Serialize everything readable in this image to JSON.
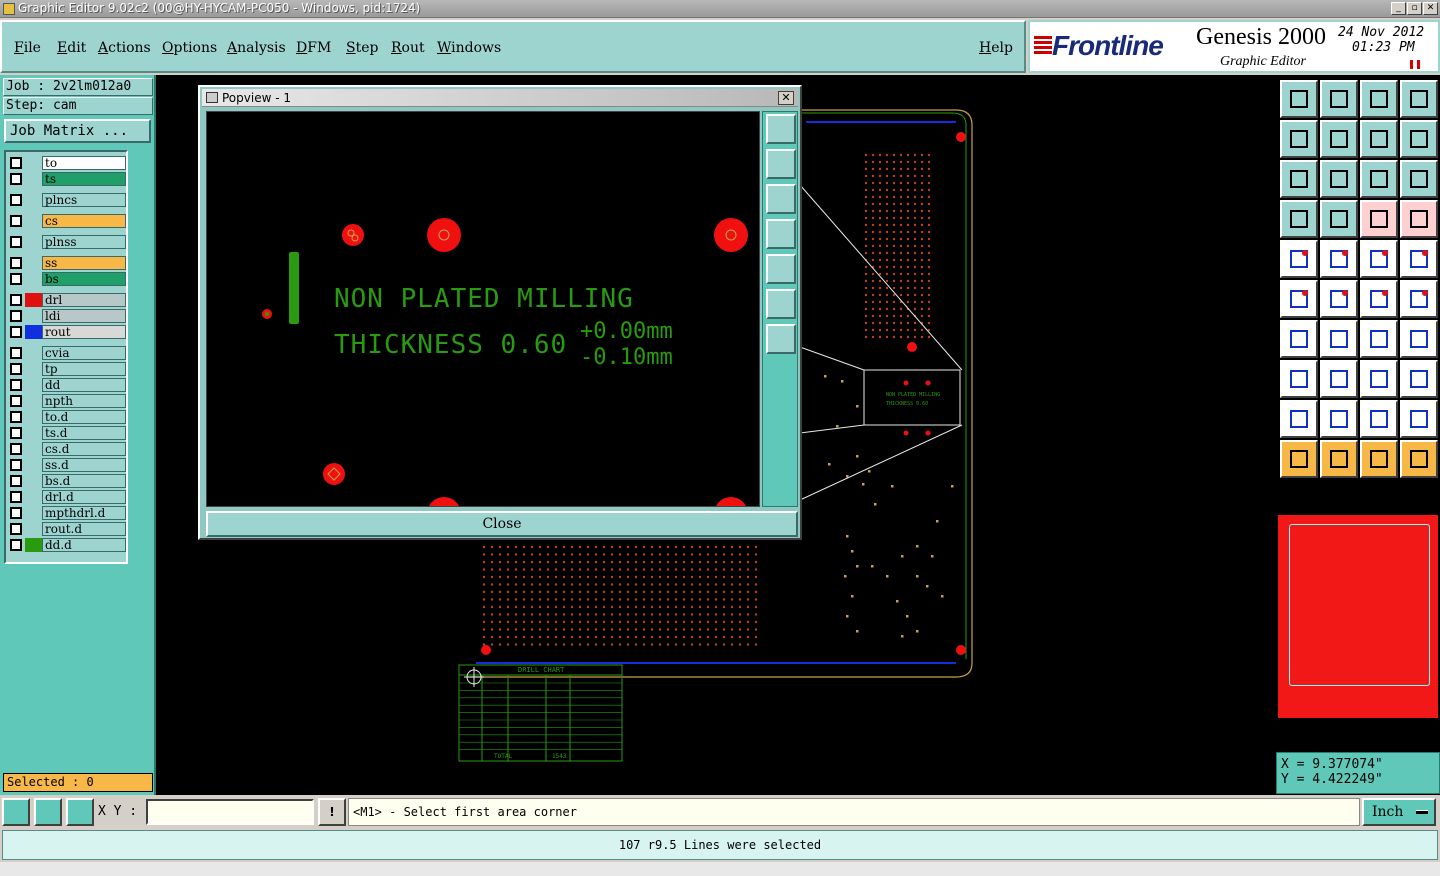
{
  "window": {
    "title": "Graphic Editor 9.02c2 (00@HY-HYCAM-PC050 - Windows, pid:1724)",
    "controls": [
      "_",
      "▫",
      "✕"
    ]
  },
  "menu": {
    "items": [
      "File",
      "Edit",
      "Actions",
      "Options",
      "Analysis",
      "DFM",
      "Step",
      "Rout",
      "Windows"
    ],
    "help": "Help"
  },
  "brand": {
    "logo": "Frontline",
    "product": "Genesis 2000",
    "subtitle": "Graphic Editor",
    "date": "24 Nov 2012",
    "time": "01:23 PM"
  },
  "job": {
    "job_line": "Job : 2v2lm012a0",
    "step_line": "Step: cam",
    "matrix_button": "Job Matrix ..."
  },
  "layers": [
    {
      "name": "to",
      "color": "#ffffff",
      "swatch": ""
    },
    {
      "name": "ts",
      "color": "#20a068",
      "swatch": ""
    },
    {
      "name": "plncs",
      "color": "#9ed4d0",
      "swatch": ""
    },
    {
      "name": "cs",
      "color": "#f8b848",
      "swatch": ""
    },
    {
      "name": "plnss",
      "color": "#9ed4d0",
      "swatch": ""
    },
    {
      "name": "ss",
      "color": "#f8b848",
      "swatch": ""
    },
    {
      "name": "bs",
      "color": "#20a068",
      "swatch": ""
    },
    {
      "name": "drl",
      "color": "#b8c8c8",
      "swatch": "#e01010"
    },
    {
      "name": "ldi",
      "color": "#b8c8c8",
      "swatch": ""
    },
    {
      "name": "rout",
      "color": "#d8d8d8",
      "swatch": "#1030e0"
    },
    {
      "name": "cvia",
      "color": "#9ed4d0",
      "swatch": ""
    },
    {
      "name": "tp",
      "color": "#9ed4d0",
      "swatch": ""
    },
    {
      "name": "dd",
      "color": "#9ed4d0",
      "swatch": ""
    },
    {
      "name": "npth",
      "color": "#9ed4d0",
      "swatch": ""
    },
    {
      "name": "to.d",
      "color": "#9ed4d0",
      "swatch": ""
    },
    {
      "name": "ts.d",
      "color": "#9ed4d0",
      "swatch": ""
    },
    {
      "name": "cs.d",
      "color": "#9ed4d0",
      "swatch": ""
    },
    {
      "name": "ss.d",
      "color": "#9ed4d0",
      "swatch": ""
    },
    {
      "name": "bs.d",
      "color": "#9ed4d0",
      "swatch": ""
    },
    {
      "name": "drl.d",
      "color": "#9ed4d0",
      "swatch": ""
    },
    {
      "name": "mpthdrl.d",
      "color": "#9ed4d0",
      "swatch": ""
    },
    {
      "name": "rout.d",
      "color": "#9ed4d0",
      "swatch": ""
    },
    {
      "name": "dd.d",
      "color": "#9ed4d0",
      "swatch": "#2a9a10"
    }
  ],
  "selected": "Selected : 0",
  "popview": {
    "title": "Popview - 1",
    "line1": "NON PLATED MILLING",
    "line2": "THICKNESS 0.60",
    "tol_plus": "+0.00mm",
    "tol_minus": "-0.10mm",
    "close_label": "Close"
  },
  "board": {
    "drill_chart_title": "DRILL CHART",
    "drill_chart_total": "TOTAL",
    "drill_chart_total_value": "1543",
    "small_text1": "NON PLATED MILLING",
    "small_text2": "THICKNESS 0.60"
  },
  "coords": {
    "x": "X = 9.377074\"",
    "y": "Y = 4.422249\""
  },
  "bottom": {
    "xy_label": "X Y :",
    "xy_value": "",
    "prompt": "<M1> - Select first area corner",
    "units": "Inch",
    "status": "107 r9.5 Lines were selected"
  },
  "colors": {
    "panel": "#5fc8b8",
    "menu": "#9ed4d0",
    "canvas": "#000000",
    "trace_green": "#2a9a10",
    "pad_red": "#f01010"
  }
}
